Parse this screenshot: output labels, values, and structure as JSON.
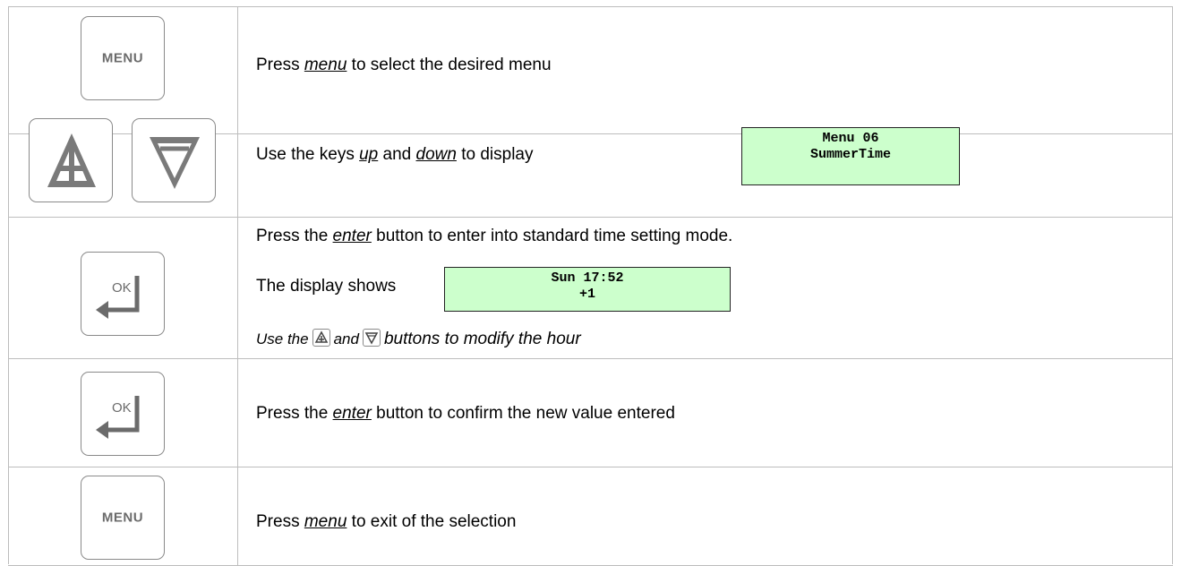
{
  "rows": [
    {
      "key": {
        "type": "menu-key",
        "label": "MENU"
      },
      "text": {
        "before": "Press ",
        "link": "menu",
        "after": " to select the desired menu"
      }
    },
    {
      "keys": [
        {
          "type": "up-key",
          "icon": "up-triangle-plus-icon"
        },
        {
          "type": "down-key",
          "icon": "down-triangle-icon"
        }
      ],
      "text": {
        "before": "Use the keys ",
        "link1": "up",
        "middle": " and ",
        "link2": "down",
        "after": " to display"
      },
      "lcd": {
        "line1": "Menu 06",
        "line2": "SummerTime"
      }
    },
    {
      "key": {
        "type": "ok-key",
        "label": "OK"
      },
      "line1": {
        "before": "Press the ",
        "link": "enter",
        "after": " button to enter into standard time setting mode."
      },
      "line2": {
        "text": "The display shows"
      },
      "lcd": {
        "line1": "Sun 17:52",
        "line2": "+1"
      },
      "line3": {
        "before": "Use the",
        "middle": "and",
        "after": "buttons to modify the hour"
      }
    },
    {
      "key": {
        "type": "ok-key",
        "label": "OK"
      },
      "text": {
        "before": "Press the ",
        "link": "enter",
        "after": " button to confirm the new value entered"
      }
    },
    {
      "key": {
        "type": "menu-key",
        "label": "MENU"
      },
      "text": {
        "before": "Press ",
        "link": "menu",
        "after": " to exit of the selection"
      }
    }
  ],
  "colors": {
    "lcd_background": "#ccffcc",
    "grid": "#bdbdbd",
    "key_border": "#8a8a8a"
  }
}
